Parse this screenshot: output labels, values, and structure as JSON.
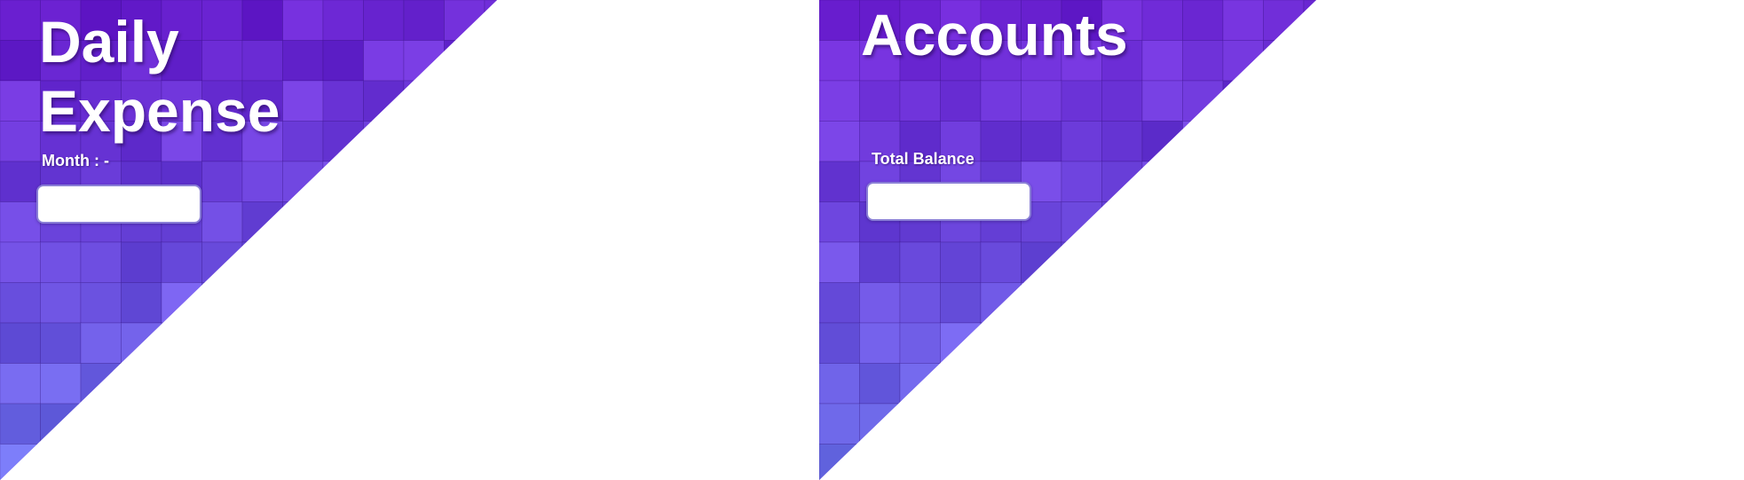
{
  "daily": {
    "title": "Daily Expense",
    "month_label": "Month : -",
    "month_value": ""
  },
  "accounts": {
    "title": "Accounts",
    "balance_label": "Total Balance",
    "balance_value": ""
  },
  "colors": {
    "tile_top": "#6a1fd0",
    "tile_bottom": "#6f7ef0",
    "text": "#ffffff",
    "background": "#ffffff"
  }
}
